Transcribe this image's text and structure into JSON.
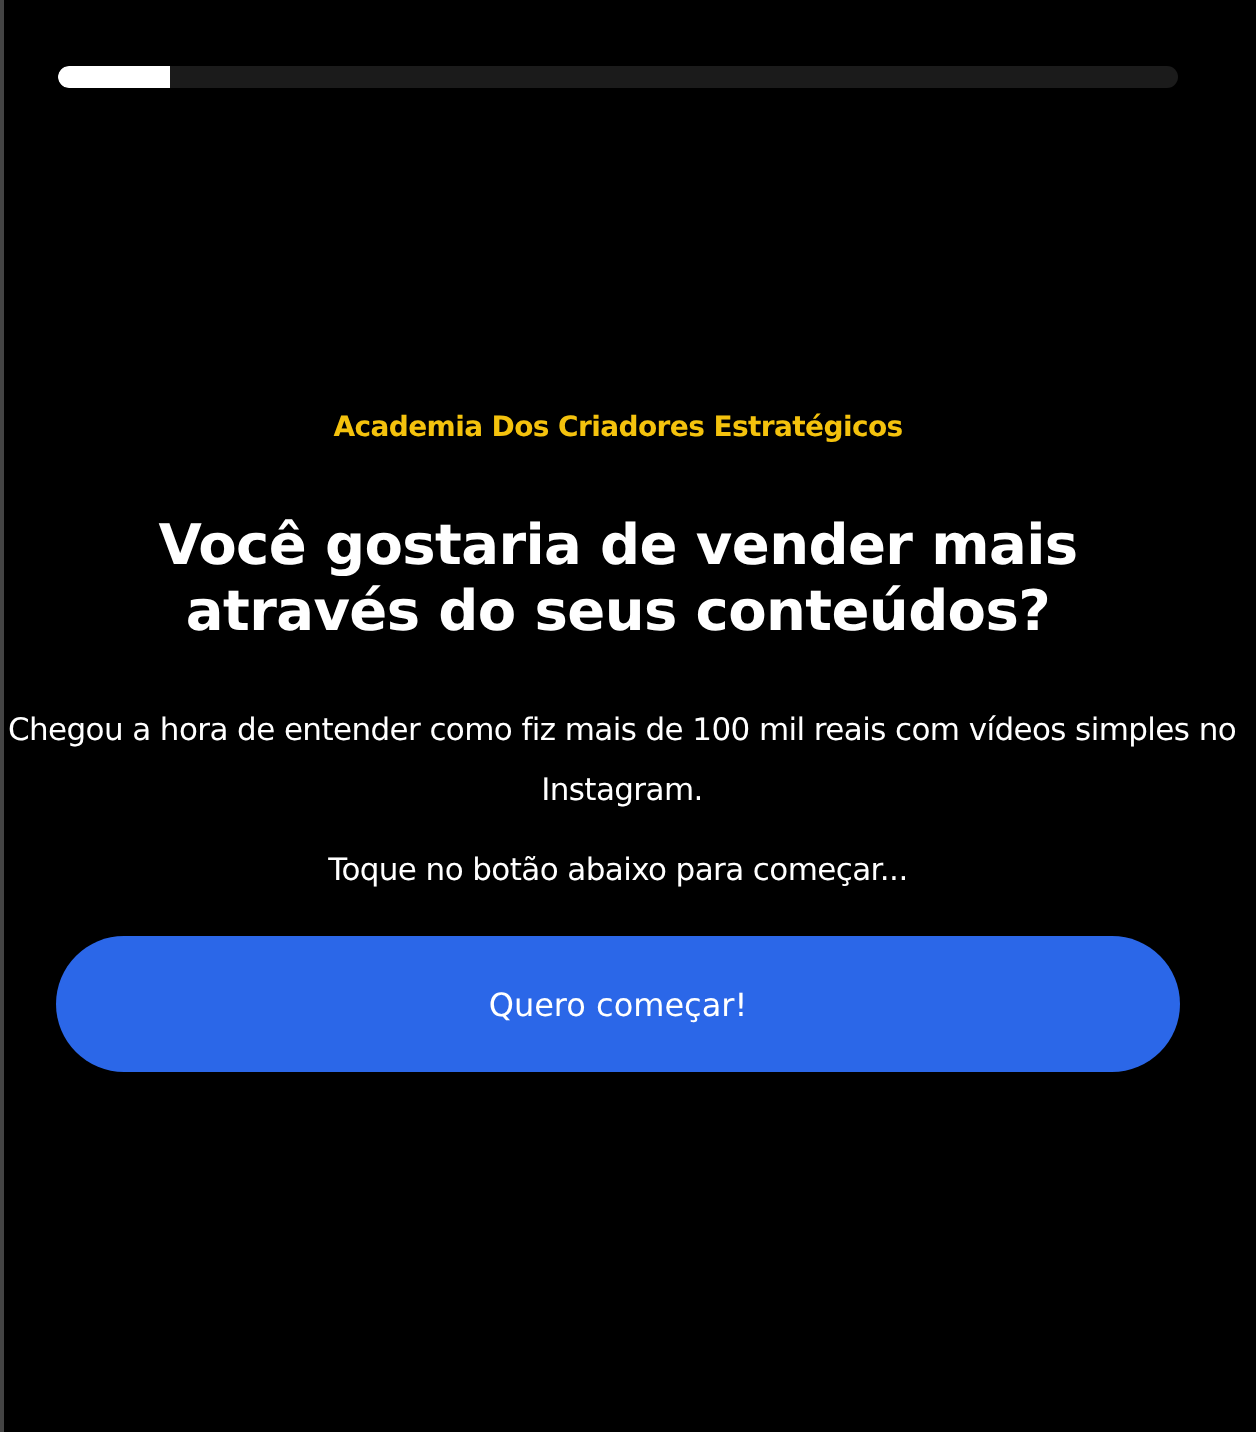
{
  "progress": {
    "level": 0.1
  },
  "brand": "Academia Dos Criadores Estratégicos",
  "headline": "Você gostaria de vender mais através do seus conteúdos?",
  "description": "Chegou a hora de entender como fiz mais de 100 mil reais com vídeos simples no Instagram.",
  "hint": "Toque no botão abaixo para começar...",
  "button": "Quero começar!"
}
